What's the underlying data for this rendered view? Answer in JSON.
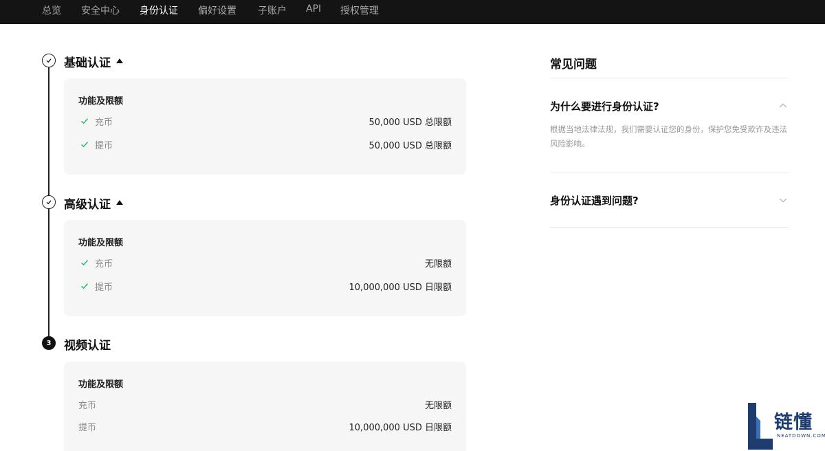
{
  "nav": {
    "items": [
      {
        "label": "总览",
        "active": false
      },
      {
        "label": "安全中心",
        "active": false
      },
      {
        "label": "身份认证",
        "active": true
      },
      {
        "label": "偏好设置",
        "active": false
      },
      {
        "label": "子账户",
        "active": false
      },
      {
        "label": "API",
        "active": false
      },
      {
        "label": "授权管理",
        "active": false
      }
    ]
  },
  "steps": [
    {
      "title": "基础认证",
      "status": "completed",
      "heading": "功能及限额",
      "rows": [
        {
          "label": "充币",
          "value": "50,000 USD 总限额",
          "checked": true
        },
        {
          "label": "提币",
          "value": "50,000 USD 总限额",
          "checked": true
        }
      ]
    },
    {
      "title": "高级认证",
      "status": "completed",
      "heading": "功能及限额",
      "rows": [
        {
          "label": "充币",
          "value": "无限额",
          "checked": true
        },
        {
          "label": "提币",
          "value": "10,000,000 USD 日限额",
          "checked": true
        }
      ]
    },
    {
      "title": "视频认证",
      "status": "pending",
      "number": "3",
      "heading": "功能及限额",
      "rows": [
        {
          "label": "充币",
          "value": "无限额",
          "checked": false
        },
        {
          "label": "提币",
          "value": "10,000,000 USD 日限额",
          "checked": false
        }
      ]
    }
  ],
  "faq": {
    "title": "常见问题",
    "items": [
      {
        "question": "为什么要进行身份认证?",
        "answer": "根据当地法律法规，我们需要认证您的身份，保护您免受欺诈及违法风险影响。",
        "expanded": true
      },
      {
        "question": "身份认证遇到问题?",
        "expanded": false
      }
    ]
  },
  "watermark": {
    "text": "链懂",
    "sub": "NEATDOWN.COM"
  },
  "colors": {
    "nav_bg": "#141414",
    "check_green": "#2eb872",
    "card_bg": "#f6f6f6",
    "brand_blue": "#1e3c6e"
  }
}
